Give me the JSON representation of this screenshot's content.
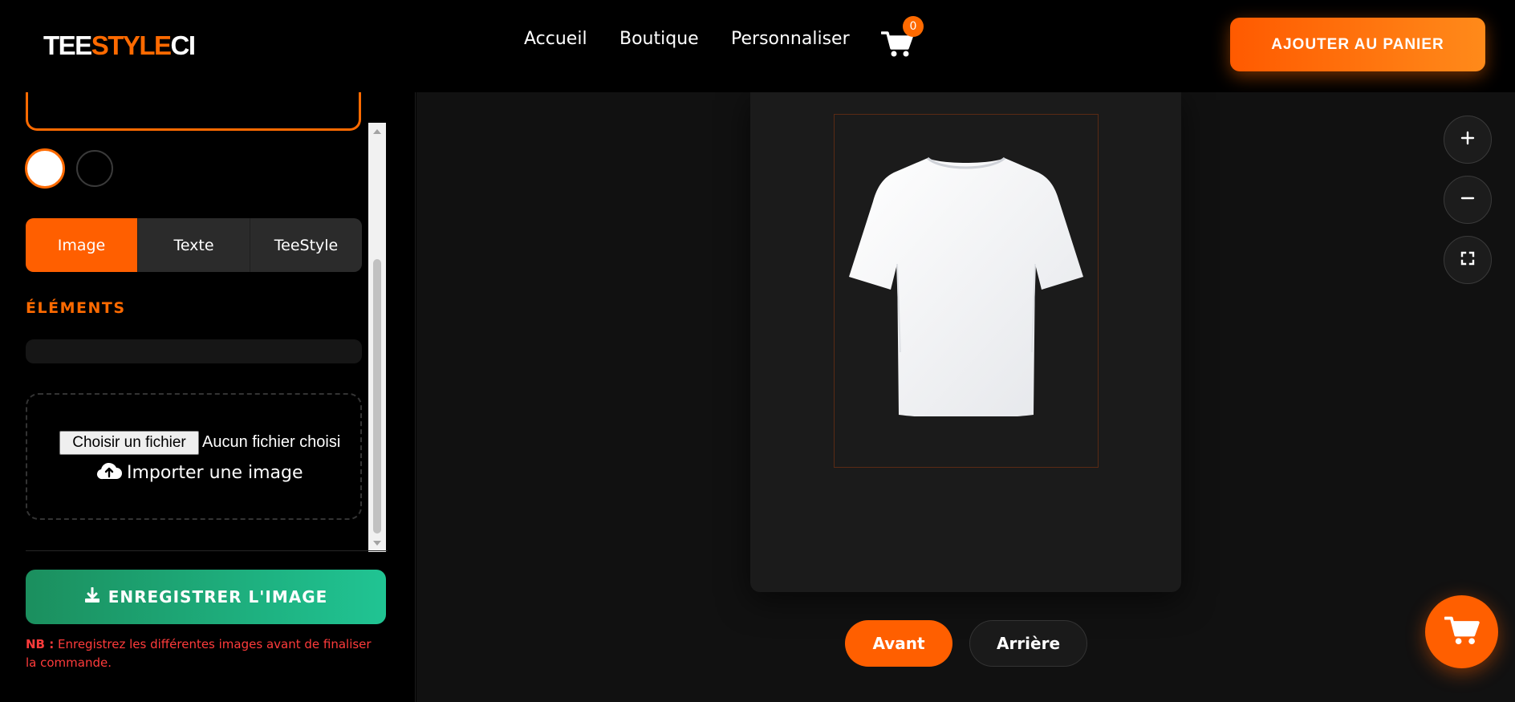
{
  "header": {
    "logo_part1": "TEE",
    "logo_part2": "STYLE",
    "logo_part3": "CI",
    "nav": [
      {
        "label": "Accueil"
      },
      {
        "label": "Boutique"
      },
      {
        "label": "Personnaliser"
      }
    ],
    "cart_count": "0",
    "add_to_cart_label": "AJOUTER AU PANIER"
  },
  "sidebar": {
    "colors": [
      {
        "name": "white",
        "hex": "#ffffff",
        "selected": true
      },
      {
        "name": "black",
        "hex": "#000000",
        "selected": false
      }
    ],
    "tabs": [
      {
        "label": "Image",
        "active": true
      },
      {
        "label": "Texte",
        "active": false
      },
      {
        "label": "TeeStyle",
        "active": false
      }
    ],
    "elements_title": "ÉLÉMENTS",
    "file_button_label": "Choisir un fichier",
    "file_status": "Aucun fichier choisi",
    "upload_label": "Importer une image",
    "save_button_label": "ENREGISTRER L'IMAGE",
    "note_prefix": "NB :",
    "note_text": "Enregistrez les différentes images avant de finaliser la commande."
  },
  "canvas": {
    "product_color": "#ffffff",
    "view_front_label": "Avant",
    "view_back_label": "Arrière",
    "tools": [
      "zoom-in-icon",
      "zoom-out-icon",
      "fullscreen-icon"
    ]
  },
  "theme": {
    "accent": "#ff6a00",
    "save_green": "#1fb886",
    "note_red": "#ff3b3b"
  }
}
